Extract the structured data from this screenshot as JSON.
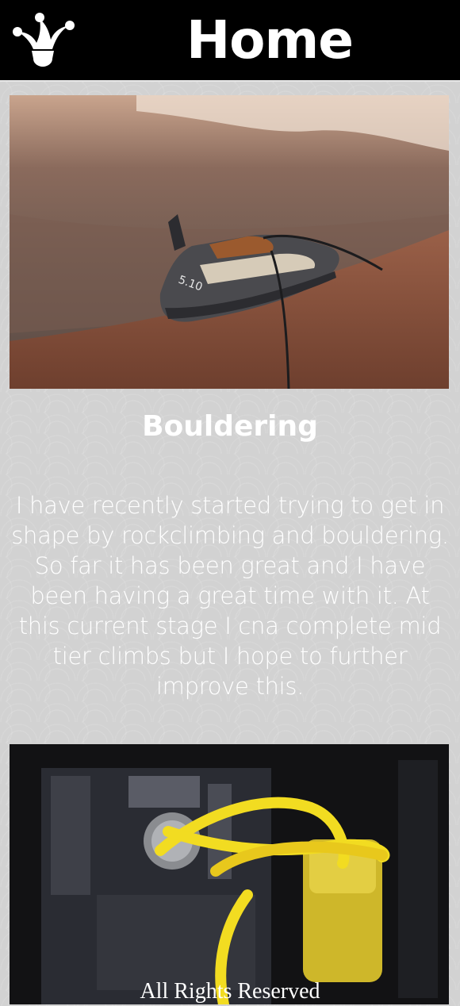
{
  "header": {
    "title": "Home",
    "logo_icon": "jester-hat-icon"
  },
  "section": {
    "title": "Bouldering",
    "text": "I have recently started trying to get in shape by rockclimbing and bouldering. So far it has been great and I have been having a great time with it. At this current stage I cna complete mid tier climbs but I hope to further improve this."
  },
  "footer": {
    "text": "All Rights Reserved"
  },
  "colors": {
    "header_bg": "#000000",
    "page_bg": "#d2d2d2",
    "text": "#ffffff"
  }
}
